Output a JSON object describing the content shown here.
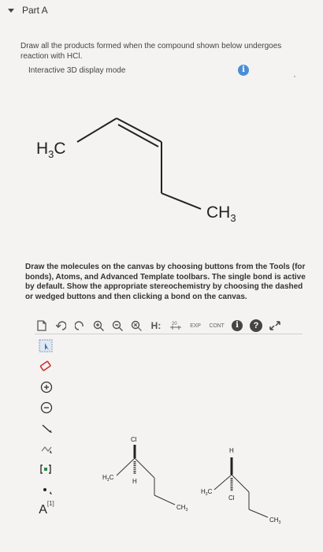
{
  "part": {
    "title": "Part A"
  },
  "question": {
    "text": "Draw all the products formed when the compound shown below undergoes reaction with HCl.",
    "mode_label": "Interactive 3D display mode",
    "info_icon": "info-icon"
  },
  "molecule": {
    "left_group": {
      "main": "H",
      "sub": "3",
      "tail": "C"
    },
    "right_group": {
      "main": "CH",
      "sub": "3"
    }
  },
  "instructions": "Draw the molecules on the canvas by choosing buttons from the Tools (for bonds), Atoms, and Advanced Template toolbars. The single bond is active by default. Show the appropriate stereochemistry by choosing the dashed or wedged buttons and then clicking a bond on the canvas.",
  "toolbar": {
    "h_label": "H:",
    "exp_label": "EXP",
    "cont_label": "CONT",
    "help_label": "?",
    "info_label": "i",
    "label_20": "20",
    "icons": [
      "document-icon",
      "undo-icon",
      "redo-icon",
      "zoom-in-icon",
      "zoom-out-icon",
      "reset-zoom-icon",
      "hydrogen-icon",
      "template-icon",
      "exp-icon",
      "cont-icon",
      "info-icon",
      "help-icon",
      "fullscreen-icon"
    ]
  },
  "left_tools": {
    "icons": [
      "select-icon",
      "eraser-icon",
      "positive-charge-icon",
      "negative-charge-icon",
      "single-bond-icon",
      "chain-icon",
      "bracket-icon",
      "radical-icon",
      "atom-label-icon"
    ],
    "atom_label": "A",
    "bracket_label": "[1]"
  },
  "canvas": {
    "product1": {
      "cl": "Cl",
      "h": "H",
      "h3c": {
        "main": "H",
        "sub": "3",
        "tail": "C"
      },
      "ch3": {
        "main": "CH",
        "sub": "3"
      }
    },
    "product2": {
      "h": "H",
      "cl": "Cl",
      "h3c": {
        "main": "H",
        "sub": "3",
        "tail": "C"
      },
      "ch3": {
        "main": "CH",
        "sub": "3"
      }
    }
  }
}
